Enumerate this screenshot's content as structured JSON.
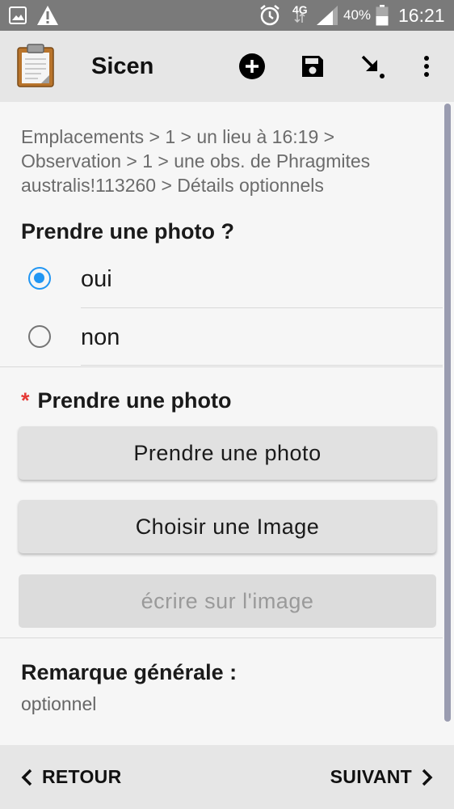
{
  "status_bar": {
    "icons": [
      "image-icon",
      "warning-icon",
      "alarm-icon",
      "network-4g-icon",
      "signal-icon",
      "battery-icon"
    ],
    "network_label": "4G",
    "battery": "40%",
    "time": "16:21"
  },
  "toolbar": {
    "app_title": "Sicen",
    "icons": [
      "clipboard-icon",
      "add-circle-icon",
      "save-icon",
      "arrow-down-right-icon",
      "overflow-menu-icon"
    ]
  },
  "breadcrumb": "Emplacements > 1 > un lieu à 16:19 > Observation > 1 > une obs. de Phragmites australis!113260 > Détails optionnels",
  "question_photo": {
    "label": "Prendre une photo ?",
    "options": [
      {
        "label": "oui",
        "selected": true
      },
      {
        "label": "non",
        "selected": false
      }
    ]
  },
  "photo_field": {
    "required_mark": "*",
    "label": "Prendre une photo",
    "take_photo_button": "Prendre une photo",
    "choose_image_button": "Choisir une Image",
    "annotate_button": "écrire sur l'image"
  },
  "remark_field": {
    "label": "Remarque générale :",
    "hint": "optionnel"
  },
  "bottom_nav": {
    "back_label": "RETOUR",
    "next_label": "SUIVANT"
  },
  "colors": {
    "accent": "#2196F3",
    "required": "#E53935",
    "toolbar_bg": "#E6E6E6",
    "status_bar_bg": "#7A7A7A"
  }
}
